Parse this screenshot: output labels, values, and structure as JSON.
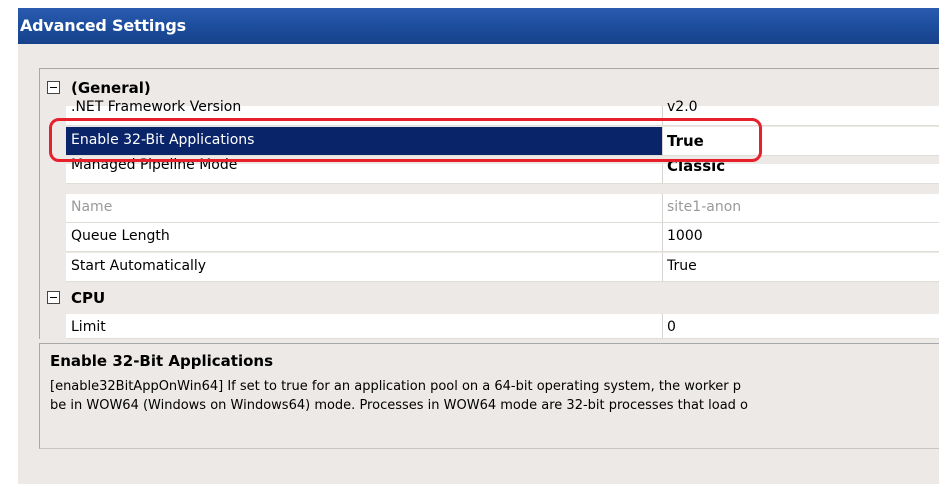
{
  "window": {
    "title": "Advanced Settings"
  },
  "categories": [
    {
      "label": "(General)"
    },
    {
      "label": "CPU"
    }
  ],
  "general_rows": [
    {
      "name": ".NET Framework Version",
      "value": "v2.0"
    },
    {
      "name": "Enable 32-Bit Applications",
      "value": "True"
    },
    {
      "name": "Managed Pipeline Mode",
      "value": "Classic"
    },
    {
      "name": "Name",
      "value": "site1-anon"
    },
    {
      "name": "Queue Length",
      "value": "1000"
    },
    {
      "name": "Start Automatically",
      "value": "True"
    }
  ],
  "cpu_rows": [
    {
      "name": "Limit",
      "value": "0"
    }
  ],
  "description": {
    "title": "Enable 32-Bit Applications",
    "line1": "[enable32BitAppOnWin64] If set to true for an application pool on a 64-bit operating system, the worker p",
    "line2": "be in WOW64 (Windows on Windows64) mode. Processes in WOW64 mode are 32-bit processes that load o"
  },
  "colors": {
    "titlebar": "#1e4f9f",
    "selection": "#0a246a",
    "annotation": "#e8202c"
  }
}
